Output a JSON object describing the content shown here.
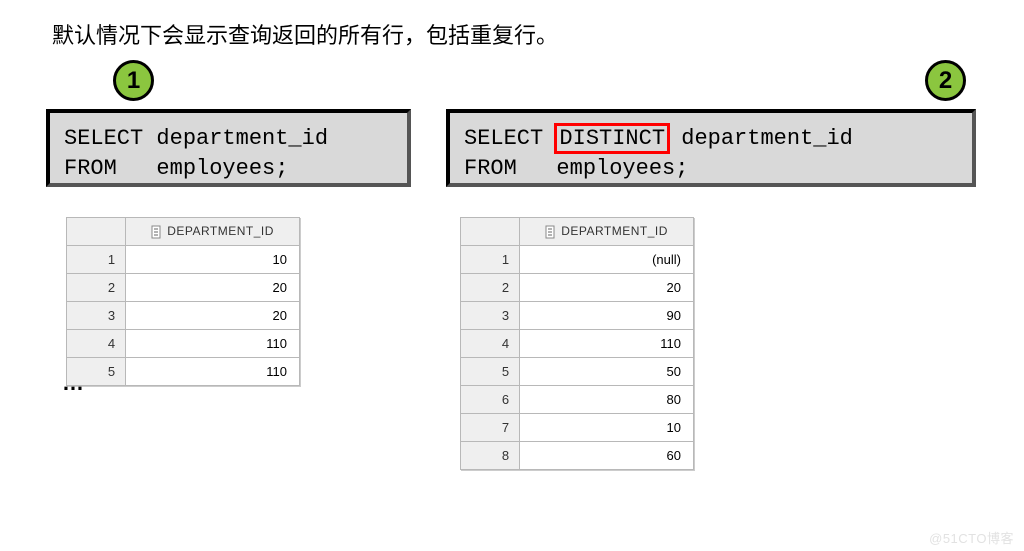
{
  "description": "默认情况下会显示查询返回的所有行，包括重复行。",
  "badges": {
    "one": "1",
    "two": "2"
  },
  "sql1": {
    "line1_a": "SELECT department_id",
    "line2_a": "FROM   employees;"
  },
  "sql2": {
    "line1_prefix": "SELECT ",
    "highlight": "DISTINCT",
    "line1_suffix": " department_id",
    "line2": "FROM   employees;"
  },
  "table_header": "DEPARTMENT_ID",
  "table1_rows": [
    {
      "n": "1",
      "v": "10"
    },
    {
      "n": "2",
      "v": "20"
    },
    {
      "n": "3",
      "v": "20"
    },
    {
      "n": "4",
      "v": "110"
    },
    {
      "n": "5",
      "v": "110"
    }
  ],
  "table2_rows": [
    {
      "n": "1",
      "v": "(null)"
    },
    {
      "n": "2",
      "v": "20"
    },
    {
      "n": "3",
      "v": "90"
    },
    {
      "n": "4",
      "v": "110"
    },
    {
      "n": "5",
      "v": "50"
    },
    {
      "n": "6",
      "v": "80"
    },
    {
      "n": "7",
      "v": "10"
    },
    {
      "n": "8",
      "v": "60"
    }
  ],
  "ellipsis": "…",
  "watermark": "@51CTO博客"
}
